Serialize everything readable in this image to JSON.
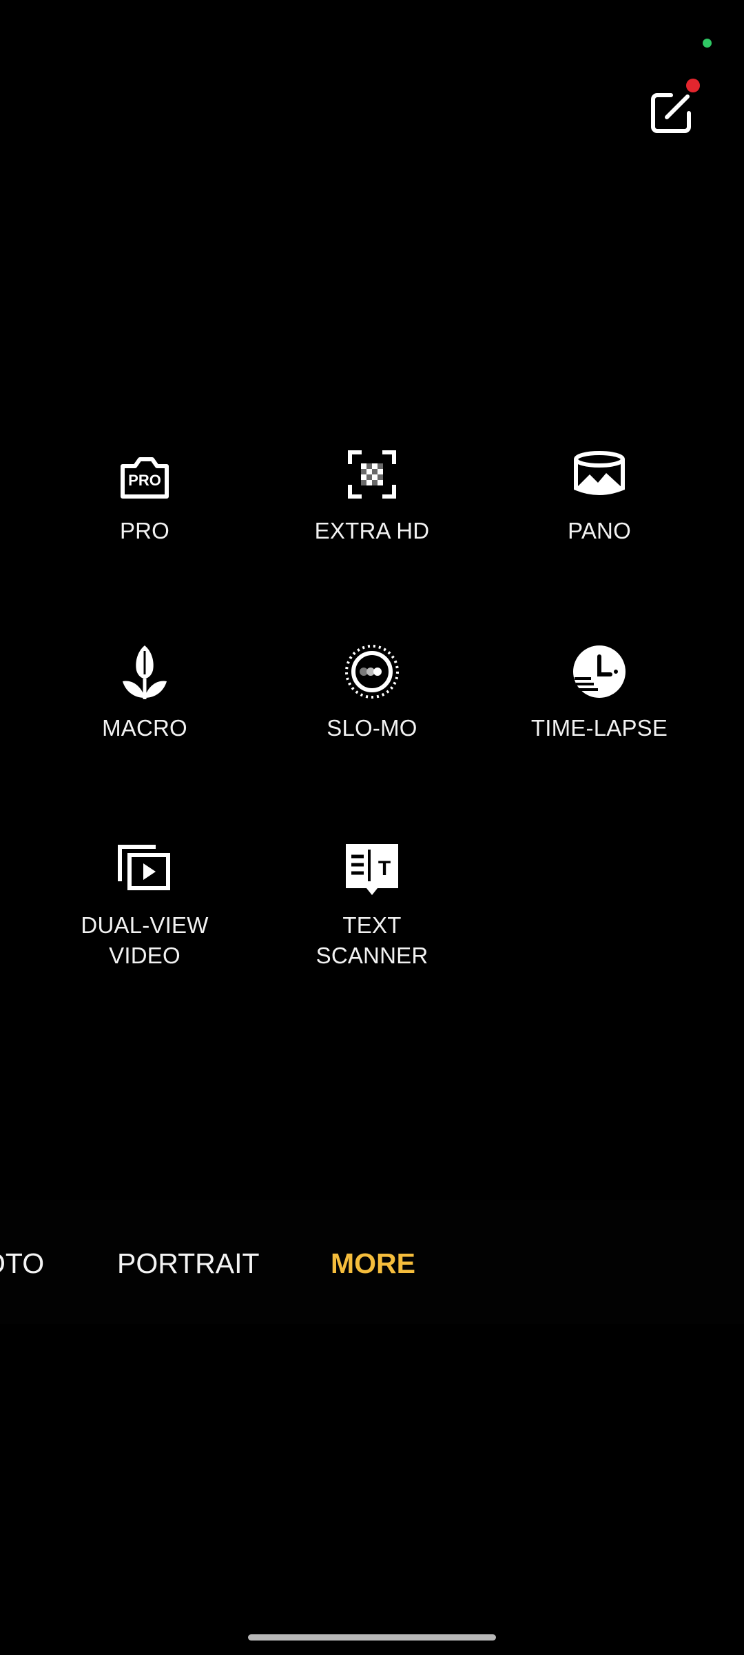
{
  "modes": [
    {
      "label": "PRO",
      "icon": "pro-camera-icon"
    },
    {
      "label": "EXTRA HD",
      "icon": "extra-hd-icon"
    },
    {
      "label": "PANO",
      "icon": "panorama-icon"
    },
    {
      "label": "MACRO",
      "icon": "macro-tulip-icon"
    },
    {
      "label": "SLO-MO",
      "icon": "slow-motion-icon"
    },
    {
      "label": "TIME-LAPSE",
      "icon": "time-lapse-clock-icon"
    },
    {
      "label_lines": [
        "DUAL-VIEW",
        "VIDEO"
      ],
      "icon": "dual-view-video-icon"
    },
    {
      "label_lines": [
        "TEXT",
        "SCANNER"
      ],
      "icon": "text-scanner-icon"
    }
  ],
  "pro_icon_text": "PRO",
  "text_scanner_icon_letter": "T",
  "mode_bar": {
    "tabs": [
      "OTO",
      "PORTRAIT",
      "MORE"
    ],
    "active": "MORE"
  },
  "colors": {
    "background": "#000000",
    "accent": "#f5bd3c",
    "status_dot": "#2fc864",
    "notification_dot": "#e3262e"
  },
  "top_controls": {
    "edit_icon": "edit-icon"
  }
}
